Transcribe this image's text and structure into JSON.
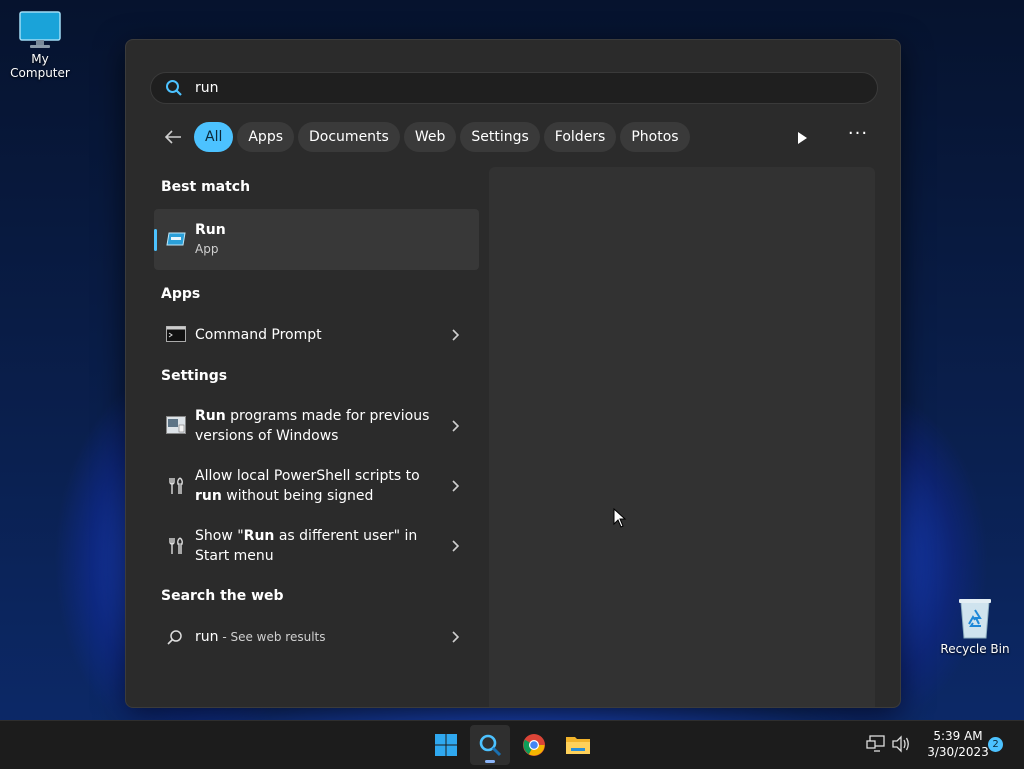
{
  "desktop": {
    "icons": [
      {
        "label": "My Computer"
      },
      {
        "label": "Recycle Bin"
      }
    ]
  },
  "search": {
    "value": "run",
    "placeholder": ""
  },
  "filters": [
    "All",
    "Apps",
    "Documents",
    "Web",
    "Settings",
    "Folders",
    "Photos"
  ],
  "active_filter": "All",
  "sections": {
    "best_match": "Best match",
    "apps": "Apps",
    "settings": "Settings",
    "web": "Search the web"
  },
  "best_match": {
    "title": "Run",
    "subtitle": "App"
  },
  "apps": [
    {
      "label": "Command Prompt"
    }
  ],
  "settings_items": [
    {
      "bold": "Run",
      "rest": " programs made for previous versions of Windows"
    },
    {
      "pre": "Allow local PowerShell scripts to ",
      "bold": "run",
      "rest": " without being signed"
    },
    {
      "pre": "Show \"",
      "bold": "Run",
      "rest": " as different user\" in Start menu"
    }
  ],
  "web": {
    "query": "run",
    "suffix": " - See web results"
  },
  "taskbar": {
    "time": "5:39 AM",
    "date": "3/30/2023",
    "notifications": "2"
  },
  "colors": {
    "accent": "#4cc2ff",
    "panel": "#2b2b2b"
  }
}
